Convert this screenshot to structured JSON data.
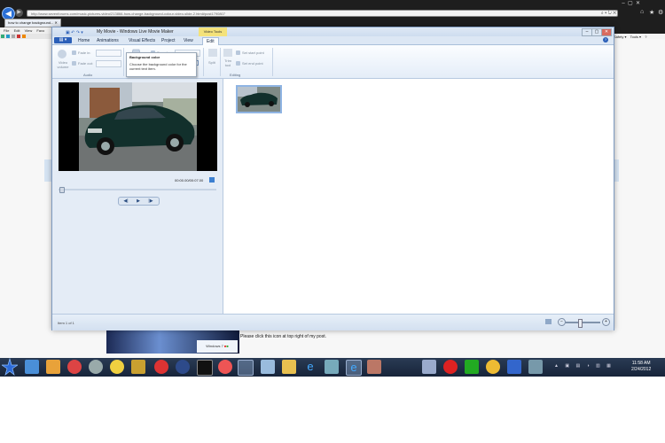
{
  "browser": {
    "address": "http://www.sevenforums.com/music-pictures-video/213866-how-change-background-colour-video-slide-2.html#post1790807",
    "tab_title": "how to change background... ✕",
    "menu": [
      "File",
      "Edit",
      "View",
      "Favo"
    ],
    "tools_label": "Tools ▾",
    "safety_label": "Safety ▾"
  },
  "movie_maker": {
    "title": "My Movie - Windows Live Movie Maker",
    "contextual_label": "Video Tools",
    "tabs": [
      "Home",
      "Animations",
      "Visual Effects",
      "Project",
      "View",
      "Edit"
    ],
    "ribbon": {
      "video_volume": "Video volume",
      "fade_in": "Fade in:",
      "fade_out": "Fade out:",
      "audio_group": "Audio",
      "background_color": "Background color ▾",
      "speed": "Speed:",
      "duration": "Duration:",
      "duration_value": "7.00",
      "adjust_group": "Adjust",
      "split": "Split",
      "trim_tool": "Trim tool",
      "set_start_point": "Set start point",
      "set_end_point": "Set end point",
      "editing_group": "Editing"
    },
    "tooltip": {
      "title": "Background color",
      "body": "Choose the background color for the current text item."
    },
    "preview": {
      "time": "00:00.00/00:07.00"
    },
    "status": "Item 1 of 1"
  },
  "webpage": {
    "please_click": "Please click this  icon at top right of my post.",
    "win7_badge": "Windows 7"
  },
  "taskbar": {
    "time": "11:58 AM",
    "date": "2/24/2012"
  }
}
